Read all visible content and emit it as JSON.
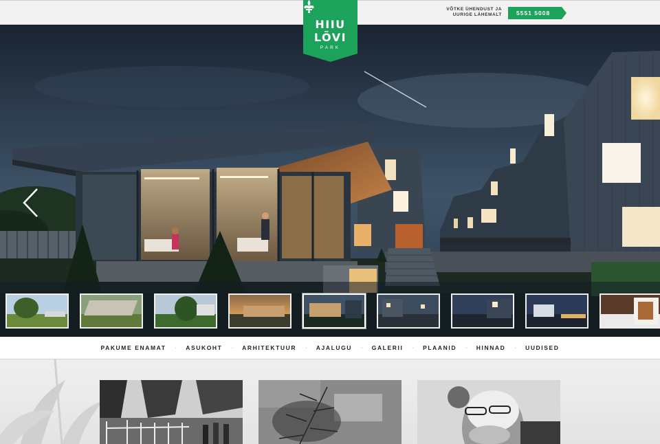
{
  "header": {
    "contact_text": "VÕTKE ÜHENDUST JA UURIGE LÄHEMALT",
    "phone": "5551 5008",
    "logo": {
      "line1": "HIIU",
      "line2": "LÕVI",
      "line3": "PARK"
    }
  },
  "colors": {
    "brand_green": "#1ca25a",
    "nav_text": "#222222"
  },
  "slider": {
    "prev_icon": "chevron-left-icon",
    "next_icon": "chevron-right-icon",
    "thumbnails_count": 9,
    "active_thumbnail": 5
  },
  "nav": {
    "items": [
      "PAKUME ENAMAT",
      "ASUKOHT",
      "ARHITEKTUUR",
      "AJALUGU",
      "GALERII",
      "PLAANID",
      "HINNAD",
      "UUDISED"
    ]
  }
}
